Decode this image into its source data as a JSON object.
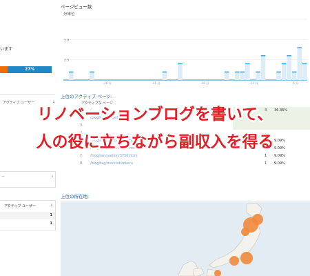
{
  "left": {
    "active_text": "います",
    "bar_percent": "27%",
    "table_header": "アクティブ ユーザー",
    "card2_header": "アクティブ ユーザー",
    "card2_sort": "↓",
    "rows": [
      "1",
      "1"
    ],
    "dash": "ー"
  },
  "chart": {
    "title": "ページビュー数",
    "unit": "分単位",
    "y_ticks": [
      "5.0",
      "2.5"
    ],
    "x_ticks": [
      "-26 分",
      "-21 分",
      "-16 分",
      "-11 分",
      "-6 分"
    ]
  },
  "chart_data": {
    "type": "bar",
    "title": "ページビュー数",
    "ylabel": "分単位",
    "ylim": [
      0,
      7.5
    ],
    "x_tick_labels": [
      "-26 分",
      "-21 分",
      "-16 分",
      "-11 分",
      "-6 分"
    ],
    "values": [
      0,
      1,
      0,
      0,
      0,
      1,
      0,
      0,
      0,
      0,
      0,
      0,
      0,
      0,
      0,
      0,
      0,
      0,
      0,
      1,
      0,
      0,
      2,
      0,
      0,
      0,
      0,
      0,
      0,
      0,
      0,
      1,
      0,
      1,
      1,
      2,
      0,
      1,
      3,
      0,
      0,
      1,
      2,
      3,
      1,
      4,
      2
    ]
  },
  "top_pages": {
    "title": "上位のアクティブ ページ:",
    "header": "アクティブな ページ",
    "rows": [
      {
        "n": "1.",
        "path": "/",
        "count": "4",
        "pct": "36.36%"
      },
      {
        "n": "2.",
        "path": "/blog/test-page1/",
        "count": "",
        "pct": ""
      },
      {
        "n": "3.",
        "path": "",
        "count": "",
        "pct": ""
      },
      {
        "n": "4.",
        "path": "",
        "count": "",
        "pct": ""
      },
      {
        "n": "5.",
        "path": "/blog/renovation/2801.html",
        "count": "1",
        "pct": "9.09%"
      },
      {
        "n": "6.",
        "path": "/blog/renovation/3701.html",
        "count": "1",
        "pct": "9.09%"
      },
      {
        "n": "7.",
        "path": "/blog/renovation/3756.html",
        "count": "1",
        "pct": "9.09%"
      },
      {
        "n": "8.",
        "path": "/blog/tag/monitekirokeru",
        "count": "1",
        "pct": "9.09%"
      }
    ]
  },
  "map": {
    "title": "上位の所在地:"
  },
  "overlay": {
    "line1": "リノベーションブログを書いて、",
    "line2": "人の役に立ちながら副収入を得る"
  },
  "colors": {
    "overlay_text": "#e31e24",
    "bar_blue": "#1e88c8",
    "bar_orange": "#ef6c00",
    "map_marker": "#f08a3c"
  }
}
